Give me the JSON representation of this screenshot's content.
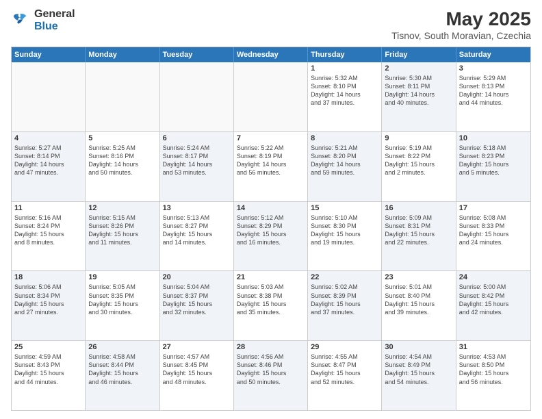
{
  "logo": {
    "general": "General",
    "blue": "Blue"
  },
  "title": "May 2025",
  "subtitle": "Tisnov, South Moravian, Czechia",
  "header_days": [
    "Sunday",
    "Monday",
    "Tuesday",
    "Wednesday",
    "Thursday",
    "Friday",
    "Saturday"
  ],
  "rows": [
    [
      {
        "num": "",
        "text": "",
        "empty": true
      },
      {
        "num": "",
        "text": "",
        "empty": true
      },
      {
        "num": "",
        "text": "",
        "empty": true
      },
      {
        "num": "",
        "text": "",
        "empty": true
      },
      {
        "num": "1",
        "text": "Sunrise: 5:32 AM\nSunset: 8:10 PM\nDaylight: 14 hours\nand 37 minutes.",
        "empty": false
      },
      {
        "num": "2",
        "text": "Sunrise: 5:30 AM\nSunset: 8:11 PM\nDaylight: 14 hours\nand 40 minutes.",
        "empty": false,
        "shaded": true
      },
      {
        "num": "3",
        "text": "Sunrise: 5:29 AM\nSunset: 8:13 PM\nDaylight: 14 hours\nand 44 minutes.",
        "empty": false
      }
    ],
    [
      {
        "num": "4",
        "text": "Sunrise: 5:27 AM\nSunset: 8:14 PM\nDaylight: 14 hours\nand 47 minutes.",
        "empty": false,
        "shaded": true
      },
      {
        "num": "5",
        "text": "Sunrise: 5:25 AM\nSunset: 8:16 PM\nDaylight: 14 hours\nand 50 minutes.",
        "empty": false
      },
      {
        "num": "6",
        "text": "Sunrise: 5:24 AM\nSunset: 8:17 PM\nDaylight: 14 hours\nand 53 minutes.",
        "empty": false,
        "shaded": true
      },
      {
        "num": "7",
        "text": "Sunrise: 5:22 AM\nSunset: 8:19 PM\nDaylight: 14 hours\nand 56 minutes.",
        "empty": false
      },
      {
        "num": "8",
        "text": "Sunrise: 5:21 AM\nSunset: 8:20 PM\nDaylight: 14 hours\nand 59 minutes.",
        "empty": false,
        "shaded": true
      },
      {
        "num": "9",
        "text": "Sunrise: 5:19 AM\nSunset: 8:22 PM\nDaylight: 15 hours\nand 2 minutes.",
        "empty": false
      },
      {
        "num": "10",
        "text": "Sunrise: 5:18 AM\nSunset: 8:23 PM\nDaylight: 15 hours\nand 5 minutes.",
        "empty": false,
        "shaded": true
      }
    ],
    [
      {
        "num": "11",
        "text": "Sunrise: 5:16 AM\nSunset: 8:24 PM\nDaylight: 15 hours\nand 8 minutes.",
        "empty": false
      },
      {
        "num": "12",
        "text": "Sunrise: 5:15 AM\nSunset: 8:26 PM\nDaylight: 15 hours\nand 11 minutes.",
        "empty": false,
        "shaded": true
      },
      {
        "num": "13",
        "text": "Sunrise: 5:13 AM\nSunset: 8:27 PM\nDaylight: 15 hours\nand 14 minutes.",
        "empty": false
      },
      {
        "num": "14",
        "text": "Sunrise: 5:12 AM\nSunset: 8:29 PM\nDaylight: 15 hours\nand 16 minutes.",
        "empty": false,
        "shaded": true
      },
      {
        "num": "15",
        "text": "Sunrise: 5:10 AM\nSunset: 8:30 PM\nDaylight: 15 hours\nand 19 minutes.",
        "empty": false
      },
      {
        "num": "16",
        "text": "Sunrise: 5:09 AM\nSunset: 8:31 PM\nDaylight: 15 hours\nand 22 minutes.",
        "empty": false,
        "shaded": true
      },
      {
        "num": "17",
        "text": "Sunrise: 5:08 AM\nSunset: 8:33 PM\nDaylight: 15 hours\nand 24 minutes.",
        "empty": false
      }
    ],
    [
      {
        "num": "18",
        "text": "Sunrise: 5:06 AM\nSunset: 8:34 PM\nDaylight: 15 hours\nand 27 minutes.",
        "empty": false,
        "shaded": true
      },
      {
        "num": "19",
        "text": "Sunrise: 5:05 AM\nSunset: 8:35 PM\nDaylight: 15 hours\nand 30 minutes.",
        "empty": false
      },
      {
        "num": "20",
        "text": "Sunrise: 5:04 AM\nSunset: 8:37 PM\nDaylight: 15 hours\nand 32 minutes.",
        "empty": false,
        "shaded": true
      },
      {
        "num": "21",
        "text": "Sunrise: 5:03 AM\nSunset: 8:38 PM\nDaylight: 15 hours\nand 35 minutes.",
        "empty": false
      },
      {
        "num": "22",
        "text": "Sunrise: 5:02 AM\nSunset: 8:39 PM\nDaylight: 15 hours\nand 37 minutes.",
        "empty": false,
        "shaded": true
      },
      {
        "num": "23",
        "text": "Sunrise: 5:01 AM\nSunset: 8:40 PM\nDaylight: 15 hours\nand 39 minutes.",
        "empty": false
      },
      {
        "num": "24",
        "text": "Sunrise: 5:00 AM\nSunset: 8:42 PM\nDaylight: 15 hours\nand 42 minutes.",
        "empty": false,
        "shaded": true
      }
    ],
    [
      {
        "num": "25",
        "text": "Sunrise: 4:59 AM\nSunset: 8:43 PM\nDaylight: 15 hours\nand 44 minutes.",
        "empty": false
      },
      {
        "num": "26",
        "text": "Sunrise: 4:58 AM\nSunset: 8:44 PM\nDaylight: 15 hours\nand 46 minutes.",
        "empty": false,
        "shaded": true
      },
      {
        "num": "27",
        "text": "Sunrise: 4:57 AM\nSunset: 8:45 PM\nDaylight: 15 hours\nand 48 minutes.",
        "empty": false
      },
      {
        "num": "28",
        "text": "Sunrise: 4:56 AM\nSunset: 8:46 PM\nDaylight: 15 hours\nand 50 minutes.",
        "empty": false,
        "shaded": true
      },
      {
        "num": "29",
        "text": "Sunrise: 4:55 AM\nSunset: 8:47 PM\nDaylight: 15 hours\nand 52 minutes.",
        "empty": false
      },
      {
        "num": "30",
        "text": "Sunrise: 4:54 AM\nSunset: 8:49 PM\nDaylight: 15 hours\nand 54 minutes.",
        "empty": false,
        "shaded": true
      },
      {
        "num": "31",
        "text": "Sunrise: 4:53 AM\nSunset: 8:50 PM\nDaylight: 15 hours\nand 56 minutes.",
        "empty": false
      }
    ]
  ]
}
